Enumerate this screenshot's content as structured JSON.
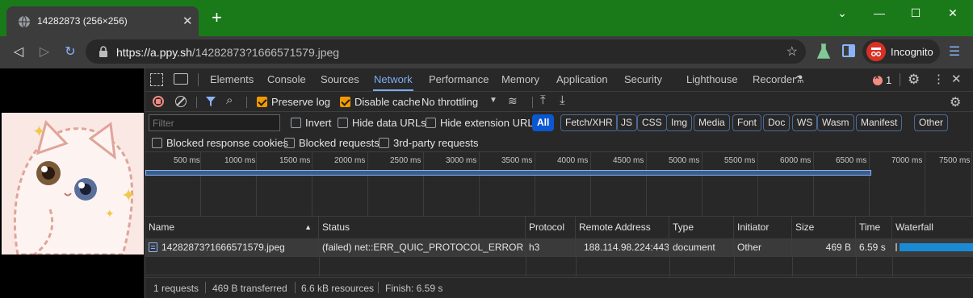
{
  "browser": {
    "tab_title": "14282873 (256×256)",
    "url_host": "https://a.ppy.sh",
    "url_path": "/14282873?1666571579.jpeg",
    "profile_label": "Incognito",
    "colors": {
      "titlebar": "#1a7a1a",
      "toolbar": "#3c3c3c"
    }
  },
  "devtools": {
    "panel_tabs": [
      "Elements",
      "Console",
      "Sources",
      "Network",
      "Performance",
      "Memory",
      "Application",
      "Security",
      "Lighthouse",
      "Recorder"
    ],
    "active_tab": "Network",
    "error_count": "1",
    "toolbar": {
      "preserve_log": "Preserve log",
      "disable_cache": "Disable cache",
      "throttling": "No throttling"
    },
    "filter": {
      "placeholder": "Filter",
      "invert": "Invert",
      "hide_data_urls": "Hide data URLs",
      "hide_extension_urls": "Hide extension URLs",
      "types": [
        "All",
        "Fetch/XHR",
        "JS",
        "CSS",
        "Img",
        "Media",
        "Font",
        "Doc",
        "WS",
        "Wasm",
        "Manifest",
        "Other"
      ],
      "blocked_response_cookies": "Blocked response cookies",
      "blocked_requests": "Blocked requests",
      "third_party_requests": "3rd-party requests"
    },
    "timeline_ticks": [
      "500 ms",
      "1000 ms",
      "1500 ms",
      "2000 ms",
      "2500 ms",
      "3000 ms",
      "3500 ms",
      "4000 ms",
      "4500 ms",
      "5000 ms",
      "5500 ms",
      "6000 ms",
      "6500 ms",
      "7000 ms",
      "7500 ms"
    ],
    "columns": {
      "name": "Name",
      "status": "Status",
      "protocol": "Protocol",
      "remote": "Remote Address",
      "type": "Type",
      "initiator": "Initiator",
      "size": "Size",
      "time": "Time",
      "waterfall": "Waterfall"
    },
    "request": {
      "name": "14282873?1666571579.jpeg",
      "status": "(failed) net::ERR_QUIC_PROTOCOL_ERROR",
      "protocol": "h3",
      "remote": "188.114.98.224:443",
      "type": "document",
      "initiator": "Other",
      "size": "469 B",
      "time": "6.59 s"
    },
    "summary": {
      "requests": "1 requests",
      "transferred": "469 B transferred",
      "resources": "6.6 kB resources",
      "finish": "Finish: 6.59 s"
    }
  }
}
